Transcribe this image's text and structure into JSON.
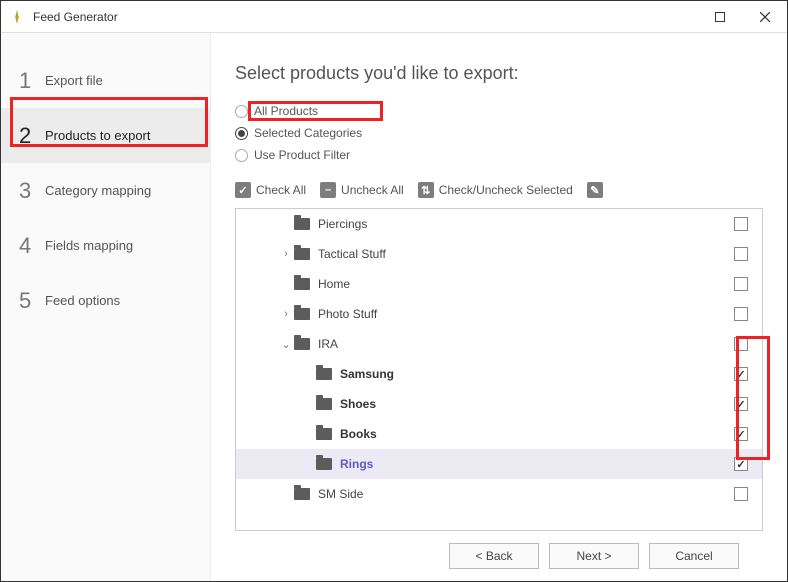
{
  "window": {
    "title": "Feed Generator"
  },
  "sidebar": {
    "steps": [
      {
        "num": "1",
        "label": "Export file",
        "active": false
      },
      {
        "num": "2",
        "label": "Products to export",
        "active": true
      },
      {
        "num": "3",
        "label": "Category mapping",
        "active": false
      },
      {
        "num": "4",
        "label": "Fields mapping",
        "active": false
      },
      {
        "num": "5",
        "label": "Feed options",
        "active": false
      }
    ]
  },
  "main": {
    "title": "Select products you'd like to export:",
    "radios": [
      {
        "label": "All Products",
        "checked": false
      },
      {
        "label": "Selected Categories",
        "checked": true
      },
      {
        "label": "Use Product Filter",
        "checked": false
      }
    ],
    "toolbar": {
      "check_all": "Check All",
      "uncheck_all": "Uncheck All",
      "toggle_selected": "Check/Uncheck Selected"
    },
    "tree": [
      {
        "indent": 1,
        "expand": "",
        "name": "Piercings",
        "strong": false,
        "selected": false,
        "checked": false
      },
      {
        "indent": 1,
        "expand": ">",
        "name": "Tactical Stuff",
        "strong": false,
        "selected": false,
        "checked": false
      },
      {
        "indent": 1,
        "expand": "",
        "name": "Home",
        "strong": false,
        "selected": false,
        "checked": false
      },
      {
        "indent": 1,
        "expand": ">",
        "name": "Photo Stuff",
        "strong": false,
        "selected": false,
        "checked": false
      },
      {
        "indent": 1,
        "expand": "v",
        "name": "IRA",
        "strong": false,
        "selected": false,
        "checked": false
      },
      {
        "indent": 2,
        "expand": "",
        "name": "Samsung",
        "strong": true,
        "selected": false,
        "checked": true
      },
      {
        "indent": 2,
        "expand": "",
        "name": "Shoes",
        "strong": true,
        "selected": false,
        "checked": true
      },
      {
        "indent": 2,
        "expand": "",
        "name": "Books",
        "strong": true,
        "selected": false,
        "checked": true
      },
      {
        "indent": 2,
        "expand": "",
        "name": "Rings",
        "strong": true,
        "selected": true,
        "checked": true,
        "link": true
      },
      {
        "indent": 1,
        "expand": "",
        "name": "SM Side",
        "strong": false,
        "selected": false,
        "checked": false
      }
    ]
  },
  "footer": {
    "back": "< Back",
    "next": "Next >",
    "cancel": "Cancel"
  }
}
